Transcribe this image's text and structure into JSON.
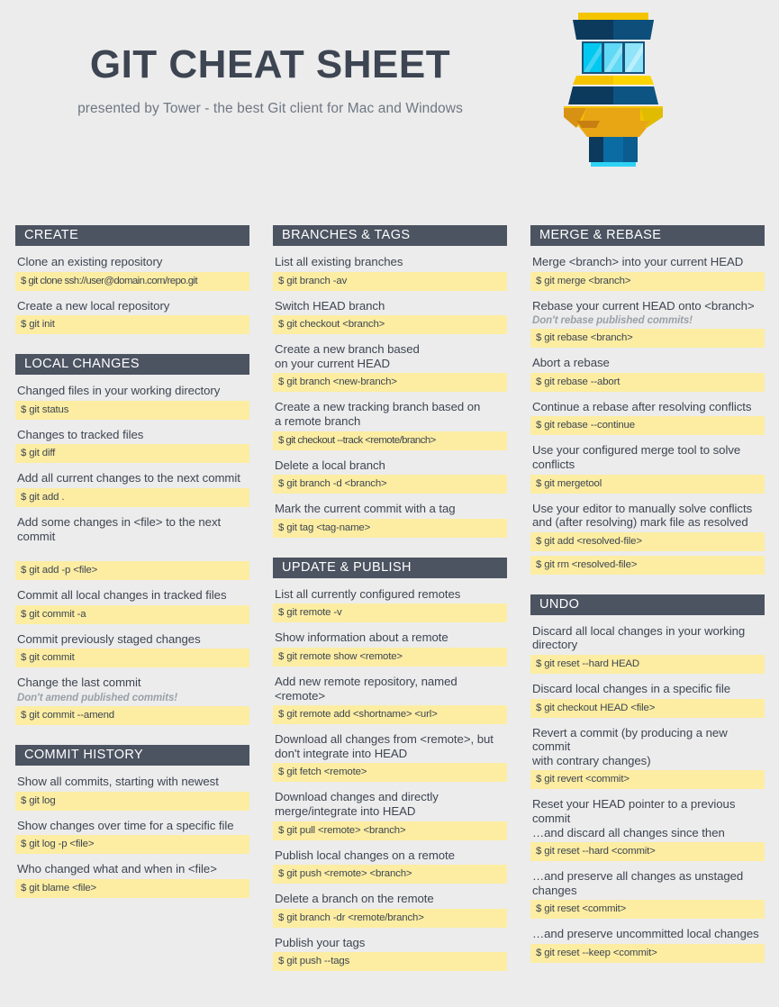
{
  "header": {
    "title": "GIT CHEAT SHEET",
    "subtitle": "presented by Tower - the best Git client for Mac and Windows",
    "logo_name": "tower-logo"
  },
  "colors": {
    "background": "#ececec",
    "section_header_bg": "#4c5361",
    "command_bg": "#fceda2",
    "text": "#3e4552",
    "muted_text": "#9aa0a8",
    "logo_yellow": "#f5c400",
    "logo_orange": "#d89213",
    "logo_dark_blue": "#0b3a5d",
    "logo_blue": "#0b6ca3",
    "logo_cyan": "#2ed2f5"
  },
  "columns": [
    {
      "sections": [
        {
          "title": "CREATE",
          "entries": [
            {
              "desc": "Clone an existing repository",
              "commands": [
                "$ git clone ssh://user@domain.com/repo.git"
              ],
              "tight": true
            },
            {
              "desc": "Create a new local repository",
              "commands": [
                "$ git init"
              ]
            }
          ]
        },
        {
          "title": "LOCAL CHANGES",
          "entries": [
            {
              "desc": "Changed files in your working directory",
              "commands": [
                "$ git status"
              ]
            },
            {
              "desc": "Changes to tracked files",
              "commands": [
                "$ git diff"
              ]
            },
            {
              "desc": "Add all current changes to the next commit",
              "commands": [
                "$ git add ."
              ]
            },
            {
              "desc": "Add some changes in <file> to the next commit",
              "spacer": true,
              "commands": [
                "$ git add -p <file>"
              ]
            },
            {
              "desc": "Commit all local changes in tracked files",
              "commands": [
                "$ git commit -a"
              ]
            },
            {
              "desc": "Commit previously staged changes",
              "commands": [
                "$ git commit"
              ]
            },
            {
              "desc": "Change the last commit",
              "warn": "Don't amend published commits!",
              "commands": [
                "$ git commit --amend"
              ]
            }
          ]
        },
        {
          "title": "COMMIT HISTORY",
          "entries": [
            {
              "desc": "Show all commits, starting with newest",
              "commands": [
                "$ git log"
              ]
            },
            {
              "desc": "Show changes over time for a specific file",
              "commands": [
                "$ git log -p <file>"
              ]
            },
            {
              "desc": "Who changed what and when in <file>",
              "commands": [
                "$ git blame <file>"
              ]
            }
          ]
        }
      ]
    },
    {
      "sections": [
        {
          "title": "BRANCHES & TAGS",
          "entries": [
            {
              "desc": "List all existing branches",
              "commands": [
                "$ git branch -av"
              ]
            },
            {
              "desc": "Switch HEAD branch",
              "commands": [
                "$ git checkout <branch>"
              ]
            },
            {
              "desc": "Create a new branch based\non your current HEAD",
              "commands": [
                "$ git branch <new-branch>"
              ]
            },
            {
              "desc": "Create a new tracking branch based on\na remote branch",
              "commands": [
                "$ git checkout --track <remote/branch>"
              ],
              "tight": true
            },
            {
              "desc": "Delete a local branch",
              "commands": [
                "$ git branch -d <branch>"
              ]
            },
            {
              "desc": "Mark the current commit with a tag",
              "commands": [
                "$ git tag <tag-name>"
              ]
            }
          ]
        },
        {
          "title": "UPDATE & PUBLISH",
          "entries": [
            {
              "desc": "List all currently configured remotes",
              "commands": [
                "$ git remote -v"
              ]
            },
            {
              "desc": "Show information about a remote",
              "commands": [
                "$ git remote show <remote>"
              ]
            },
            {
              "desc": "Add new remote repository, named <remote>",
              "commands": [
                "$ git remote add <shortname> <url>"
              ]
            },
            {
              "desc": "Download all changes from <remote>,  but\ndon't integrate into HEAD",
              "commands": [
                "$ git fetch <remote>"
              ]
            },
            {
              "desc": "Download changes and directly\nmerge/integrate  into  HEAD",
              "commands": [
                "$ git pull <remote> <branch>"
              ]
            },
            {
              "desc": "Publish local changes on a remote",
              "commands": [
                "$ git push <remote> <branch>"
              ]
            },
            {
              "desc": "Delete a branch on the remote",
              "commands": [
                "$ git branch -dr <remote/branch>"
              ]
            },
            {
              "desc": "Publish your tags",
              "commands": [
                "$ git push --tags"
              ]
            }
          ]
        }
      ]
    },
    {
      "sections": [
        {
          "title": "MERGE & REBASE",
          "entries": [
            {
              "desc": "Merge <branch> into your current HEAD",
              "commands": [
                "$ git merge <branch>"
              ]
            },
            {
              "desc": "Rebase your current HEAD onto <branch>",
              "warn": "Don't rebase published commits!",
              "commands": [
                "$ git rebase <branch>"
              ]
            },
            {
              "desc": "Abort a rebase",
              "commands": [
                "$ git rebase --abort"
              ]
            },
            {
              "desc": "Continue a rebase after resolving conflicts",
              "commands": [
                "$ git rebase --continue"
              ]
            },
            {
              "desc": "Use your configured merge tool to  solve\nconflicts",
              "commands": [
                "$ git mergetool"
              ]
            },
            {
              "desc": "Use your editor to manually solve conflicts\nand  (after resolving) mark file as resolved",
              "commands": [
                "$ git add <resolved-file>",
                "$ git rm <resolved-file>"
              ]
            }
          ]
        },
        {
          "title": "UNDO",
          "entries": [
            {
              "desc": "Discard all local changes in your working\ndirectory",
              "commands": [
                "$ git reset --hard HEAD"
              ]
            },
            {
              "desc": "Discard local changes in a specific file",
              "commands": [
                "$ git checkout HEAD <file>"
              ]
            },
            {
              "desc": "Revert a commit (by producing a new commit\nwith contrary changes)",
              "commands": [
                "$ git revert <commit>"
              ]
            },
            {
              "desc": "Reset your HEAD pointer to a previous commit\n…and discard all changes since then",
              "commands": [
                "$ git reset --hard <commit>"
              ]
            },
            {
              "desc": "…and preserve all changes as unstaged\nchanges",
              "commands": [
                "$ git reset <commit>"
              ]
            },
            {
              "desc": "…and preserve uncommitted local changes",
              "commands": [
                "$ git reset --keep <commit>"
              ]
            }
          ]
        }
      ]
    }
  ]
}
